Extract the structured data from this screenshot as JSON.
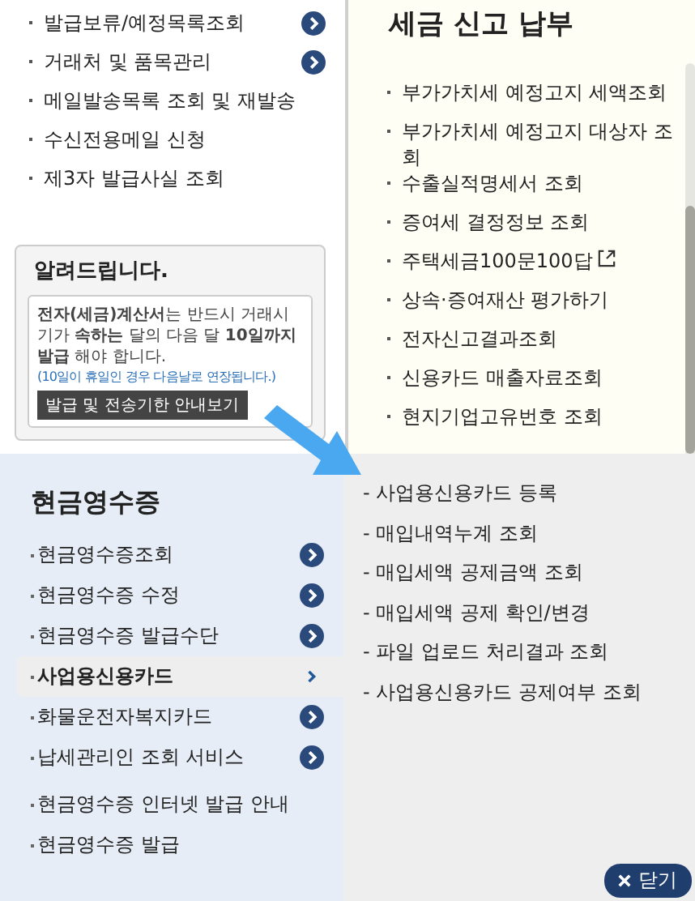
{
  "invoice_menu": {
    "items": [
      {
        "label": "발급보류/예정목록조회",
        "kind": "arrow"
      },
      {
        "label": "거래처 및 품목관리",
        "kind": "arrow"
      },
      {
        "label": "메일발송목록 조회 및 재발송",
        "kind": "plain"
      },
      {
        "label": "수신전용메일 신청",
        "kind": "plain"
      },
      {
        "label": "제3자 발급사실 조회",
        "kind": "plain"
      }
    ]
  },
  "notice": {
    "title": "알려드립니다.",
    "body": "**전자(세금)계산서**는 반드시 거래시기가 **속하는** 달의 다음 달 **10일까지 발급** 해야 합니다.",
    "note": "(10일이 휴일인 경우 다음날로 연장됩니다.)",
    "button": "발급 및 전송기한 안내보기"
  },
  "tax_panel": {
    "title": "세금 신고 납부",
    "items": [
      {
        "label": "부가가치세 예정고지 세액조회",
        "external": false
      },
      {
        "label": "부가가치세 예정고지 대상자 조회",
        "external": false
      },
      {
        "label": "수출실적명세서 조회",
        "external": false
      },
      {
        "label": "증여세 결정정보 조회",
        "external": false
      },
      {
        "label": "주택세금100문100답",
        "external": true
      },
      {
        "label": "상속·증여재산 평가하기",
        "external": false
      },
      {
        "label": "전자신고결과조회",
        "external": false
      },
      {
        "label": "신용카드 매출자료조회",
        "external": false
      },
      {
        "label": "현지기업고유번호 조회",
        "external": false
      }
    ]
  },
  "cash_receipt": {
    "title": "현금영수증",
    "items": [
      {
        "label": "현금영수증조회",
        "kind": "arrow",
        "selected": false
      },
      {
        "label": "현금영수증 수정",
        "kind": "arrow",
        "selected": false
      },
      {
        "label": "현금영수증 발급수단",
        "kind": "arrow",
        "selected": false
      },
      {
        "label": "사업용신용카드",
        "kind": "arrow",
        "selected": true
      },
      {
        "label": "화물운전자복지카드",
        "kind": "arrow",
        "selected": false
      },
      {
        "label": "납세관리인 조회 서비스",
        "kind": "arrow",
        "selected": false
      },
      {
        "label": "현금영수증 인터넷 발급 안내",
        "kind": "plain",
        "selected": false
      },
      {
        "label": "현금영수증 발급",
        "kind": "plain",
        "selected": false
      }
    ]
  },
  "submenu": {
    "items": [
      "- 사업용신용카드 등록",
      "- 매입내역누계 조회",
      "- 매입세액 공제금액 조회",
      "- 매입세액 공제 확인/변경",
      "- 파일 업로드 처리결과 조회",
      "- 사업용신용카드 공제여부 조회"
    ]
  },
  "close_button": {
    "label": "닫기"
  }
}
